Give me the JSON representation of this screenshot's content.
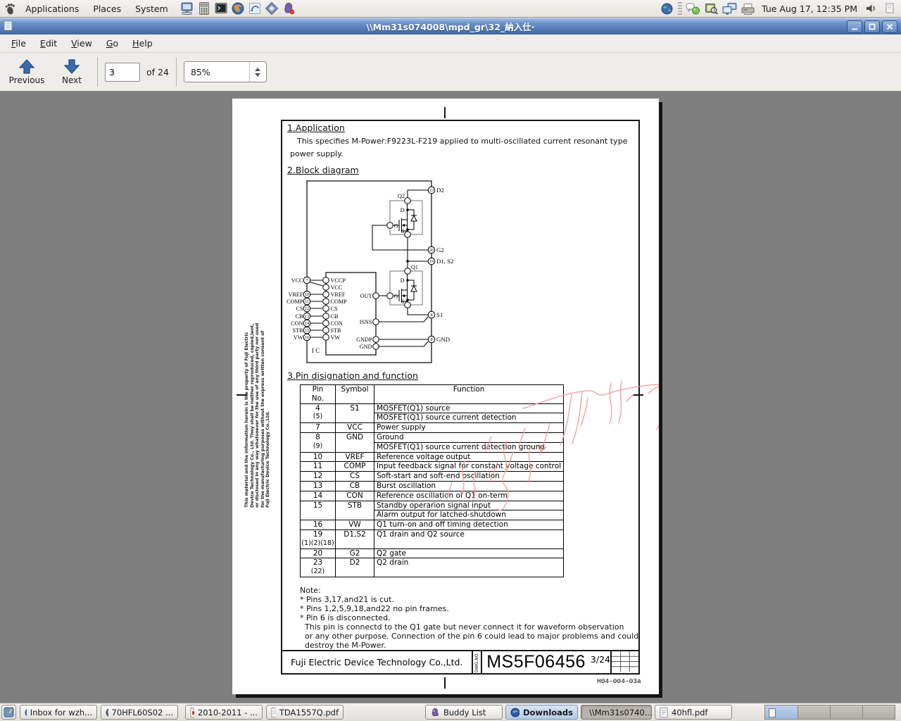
{
  "panel": {
    "menus": [
      "Applications",
      "Places",
      "System"
    ],
    "clock": "Tue Aug 17, 12:35 PM"
  },
  "window": {
    "title": "\\\\Mm31s074008\\mpd_gr\\32_納入仕·",
    "menubar": [
      "File",
      "Edit",
      "View",
      "Go",
      "Help"
    ],
    "toolbar": {
      "previous": "Previous",
      "next": "Next",
      "page_value": "3",
      "page_of": "of 24",
      "zoom_value": "85%"
    }
  },
  "doc": {
    "s1_title": "1.Application",
    "s1_line1": "This specifies M-Power:F9223L-F219 applied to multi-oscillated current resonant type",
    "s1_line2": "power supply.",
    "s2_title": "2.Block diagram",
    "s3_title": "3.Pin disignation and function",
    "diagram": {
      "ic": "I C",
      "left_pins": [
        {
          "num": "7",
          "label": "VCC"
        },
        {
          "num": "10",
          "label": "VREF"
        },
        {
          "num": "11",
          "label": "COMP"
        },
        {
          "num": "12",
          "label": "CS"
        },
        {
          "num": "13",
          "label": "CB"
        },
        {
          "num": "14",
          "label": "CON"
        },
        {
          "num": "15",
          "label": "STB"
        },
        {
          "num": "16",
          "label": "VW"
        }
      ],
      "ic_left": [
        "VCCP",
        "VCC",
        "VREF",
        "COMP",
        "CS",
        "CB",
        "CON",
        "STB",
        "VW"
      ],
      "ic_right": [
        "OUT",
        "ISNS",
        "GNDP",
        "GND"
      ],
      "right_pins": [
        {
          "num": "23",
          "label": "D2"
        },
        {
          "num": "20",
          "label": "G2"
        },
        {
          "num": "19",
          "label": "D1, S2"
        },
        {
          "num": "4",
          "label": "S1"
        },
        {
          "num": "8",
          "label": "GND"
        }
      ],
      "q1": "Q1",
      "q2": "Q2",
      "d": "D",
      "g": "G",
      "s": "S"
    },
    "table": {
      "h_pin1": "Pin",
      "h_pin2": "No.",
      "h_symbol": "Symbol",
      "h_function": "Function",
      "rows": [
        {
          "pin": "4",
          "pin2": "(5)",
          "sym": "S1",
          "fn1": "MOSFET(Q1) source",
          "fn2": "MOSFET(Q1) source current detection"
        },
        {
          "pin": "7",
          "sym": "VCC",
          "fn1": "Power supply"
        },
        {
          "pin": "8",
          "pin2": "(9)",
          "sym": "GND",
          "fn1": "Ground",
          "fn2": "MOSFET(Q1) source current detection ground"
        },
        {
          "pin": "10",
          "sym": "VREF",
          "fn1": "Reference voltage output"
        },
        {
          "pin": "11",
          "sym": "COMP",
          "fn1": "Input feedback signal for constant voltage control"
        },
        {
          "pin": "12",
          "sym": "CS",
          "fn1": "Soft-start and soft-end oscillation"
        },
        {
          "pin": "13",
          "sym": "CB",
          "fn1": "Burst oscillation"
        },
        {
          "pin": "14",
          "sym": "CON",
          "fn1": "Reference oscillation of Q1 on-term"
        },
        {
          "pin": "15",
          "sym": "STB",
          "fn1": "Standby operarion signal input",
          "fn2": "Alarm output for latched-shutdown"
        },
        {
          "pin": "16",
          "sym": "VW",
          "fn1": "Q1 turn-on and off timing detection"
        },
        {
          "pin": "19",
          "pin2": "(1)(2)(18)",
          "sym": "D1,S2",
          "fn1": "Q1 drain and Q2 source"
        },
        {
          "pin": "20",
          "sym": "G2",
          "fn1": "Q2 gate"
        },
        {
          "pin": "23",
          "pin2": "(22)",
          "sym": "D2",
          "fn1": "Q2 drain"
        }
      ]
    },
    "note_lines": [
      "Note:",
      "* Pins 3,17,and21 is cut.",
      "* Pins 1,2,5,9,18,and22 no pin frames.",
      "* Pin 6 is disconnected.",
      "This pin is connectd to the Q1 gate but never connect it for waveform observation",
      "or any other purpose. Connection of the pin 6 could lead to major problems and could",
      "destroy the M-Power."
    ],
    "side_lines": [
      "This material and the information herein is the property of Fuji Electric",
      "Device Technology Co., Ltd. They shall be neither reproduced, copied,lent,",
      "or disclosed in any way whatsoever for the use of any third party nor used",
      "for the manufacturing purposes without the express written consent of",
      "Fuji Electric Device Technology Co.,Ltd."
    ],
    "footer": {
      "company": "Fuji Electric Device Technology Co.,Ltd.",
      "dwg_label": "DWG.NO.",
      "dwg_no": "MS5F06456",
      "page": "3/24",
      "code": "H04-004-03a"
    }
  },
  "taskbar": {
    "items": [
      {
        "label": "Inbox for wzh..."
      },
      {
        "label": "70HFL60S02 ..."
      },
      {
        "label": "2010-2011 - ..."
      },
      {
        "label": "TDA1557Q.pdf"
      },
      {
        "label": "Buddy List"
      },
      {
        "label": "Downloads"
      },
      {
        "label": "\\\\Mm31s0740..."
      },
      {
        "label": "40hfl.pdf"
      }
    ]
  }
}
